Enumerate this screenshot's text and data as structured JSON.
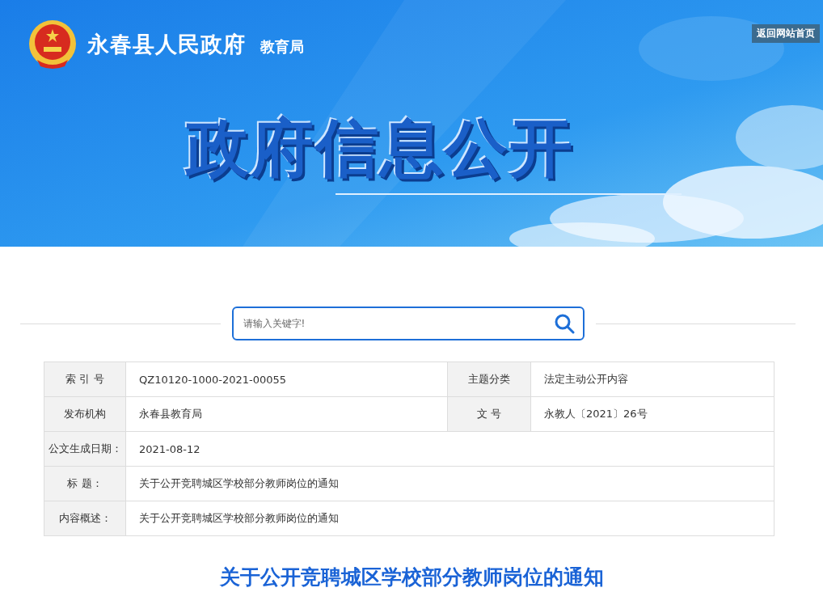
{
  "header": {
    "site_name": "永春县人民政府",
    "department": "教育局",
    "home_link": "返回网站首页",
    "banner_title": "政府信息公开"
  },
  "search": {
    "placeholder": "请输入关键字!"
  },
  "info_table": {
    "rows": [
      {
        "kind": "double",
        "cells": [
          {
            "label": "索 引 号",
            "value": "QZ10120-1000-2021-00055"
          },
          {
            "label": "主题分类",
            "value": "法定主动公开内容"
          }
        ]
      },
      {
        "kind": "double",
        "cells": [
          {
            "label": "发布机构",
            "value": "永春县教育局"
          },
          {
            "label": "文 号",
            "value": "永教人〔2021〕26号"
          }
        ]
      },
      {
        "kind": "single",
        "cells": [
          {
            "label": "公文生成日期：",
            "value": "2021-08-12"
          }
        ]
      },
      {
        "kind": "single",
        "cells": [
          {
            "label": "标 题：",
            "value": "关于公开竞聘城区学校部分教师岗位的通知"
          }
        ]
      },
      {
        "kind": "single",
        "cells": [
          {
            "label": "内容概述：",
            "value": "关于公开竞聘城区学校部分教师岗位的通知"
          }
        ]
      }
    ]
  },
  "article": {
    "title": "关于公开竞聘城区学校部分教师岗位的通知"
  }
}
